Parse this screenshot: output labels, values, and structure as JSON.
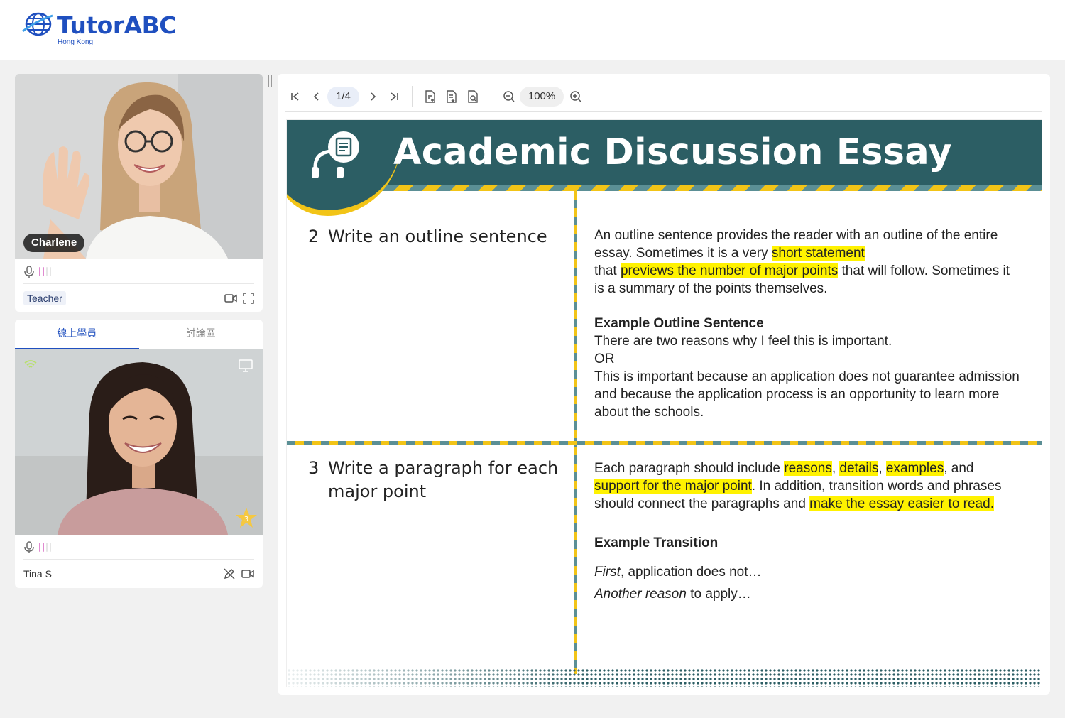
{
  "brand": {
    "name": "TutorABC",
    "region": "Hong Kong",
    "color": "#1f4fbf"
  },
  "teacher": {
    "name": "Charlene",
    "role": "Teacher"
  },
  "student_panel": {
    "tabs": [
      {
        "label": "線上學員",
        "active": true
      },
      {
        "label": "討論區",
        "active": false
      }
    ],
    "student": {
      "name": "Tina S",
      "stars": "3"
    }
  },
  "toolbar": {
    "page": "1/4",
    "zoom": "100%"
  },
  "slide": {
    "title": "Academic Discussion Essay",
    "step2": {
      "num": "2",
      "title": "Write an outline sentence",
      "body_1a": "An outline sentence provides the reader with an outline of the entire essay. Sometimes it is a very ",
      "body_1b": "short statement",
      "body_1c": "that ",
      "body_1d": "previews the number of major points",
      "body_1e": " that will follow. Sometimes it is a summary of the points themselves.",
      "example_heading": "Example Outline Sentence",
      "example_1": "There are two reasons why I feel this is important.",
      "or": "OR",
      "example_2": "This is important because an application does not guarantee admission and because the application process is an opportunity to learn more about the schools."
    },
    "step3": {
      "num": "3",
      "title_line1": "Write a paragraph for each",
      "title_line2": "major point",
      "body_a": "Each paragraph should include ",
      "hl_reasons": "reasons",
      "comma1": ", ",
      "hl_details": "details",
      "comma2": ", ",
      "hl_examples": "examples",
      "body_b": ", and ",
      "hl_support": "support for the major point",
      "body_c": ". In addition, transition words and phrases should connect the paragraphs and ",
      "hl_easier": "make the essay easier to read.",
      "example_heading": "Example Transition",
      "t1_italic": "First",
      "t1_rest": ", application does not…",
      "t2_italic": "Another reason",
      "t2_rest": " to apply…"
    }
  }
}
